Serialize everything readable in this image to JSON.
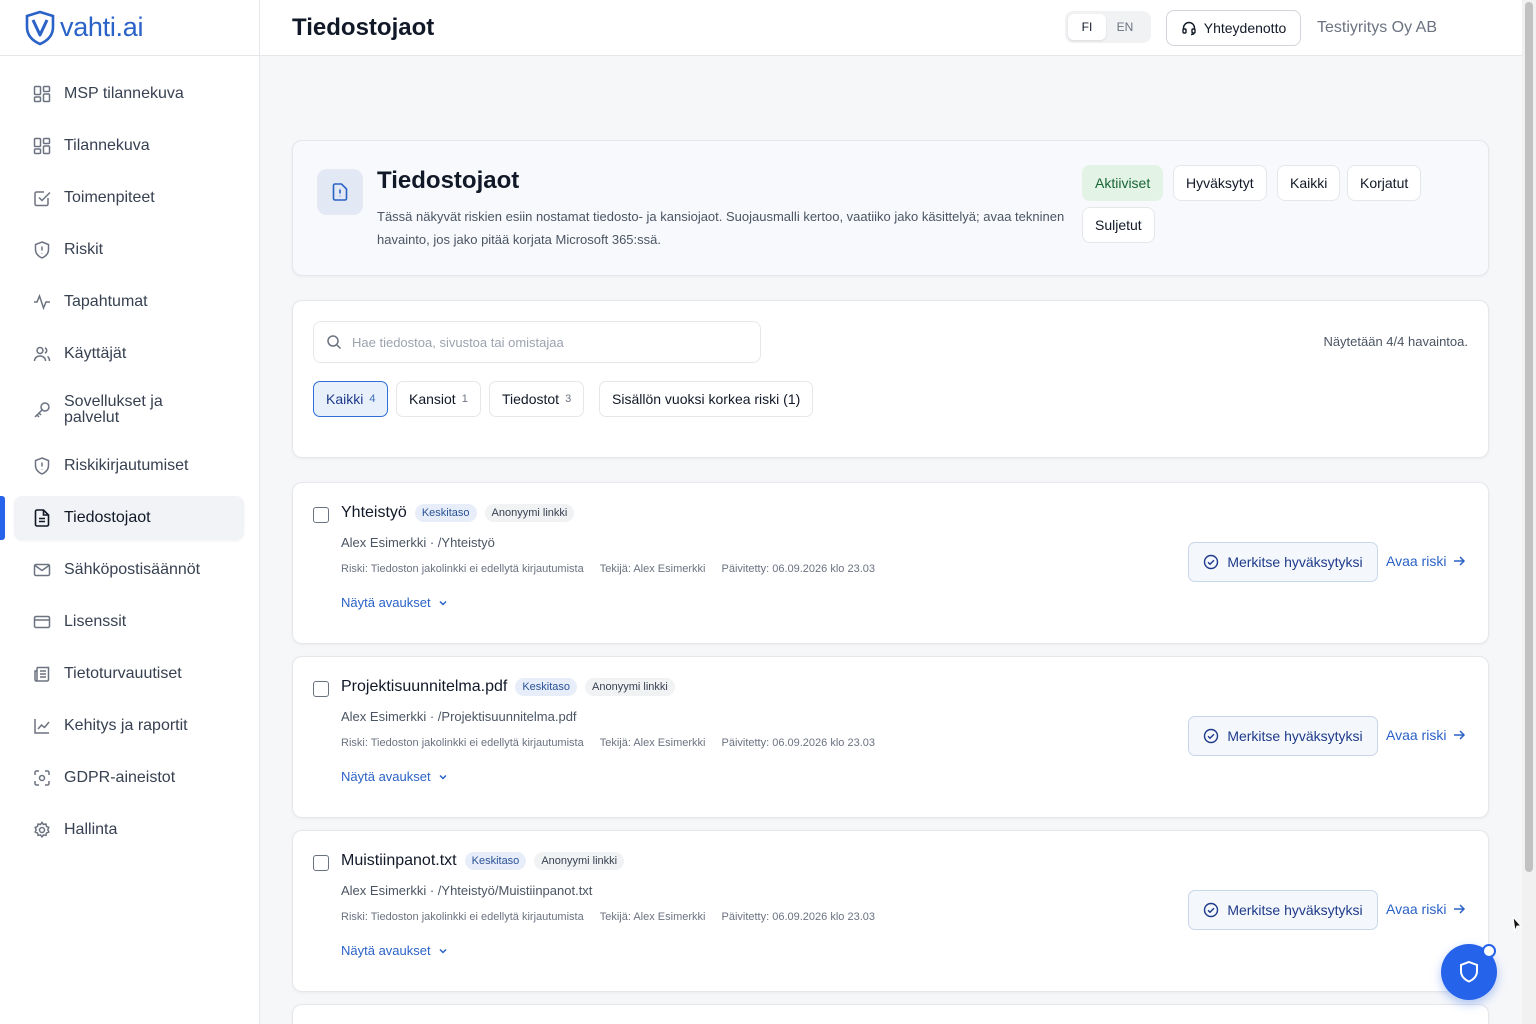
{
  "logo": {
    "text": "vahti.ai"
  },
  "sidebar": {
    "items": [
      {
        "label": "MSP tilannekuva",
        "icon": "dashboard-icon"
      },
      {
        "label": "Tilannekuva",
        "icon": "dashboard-icon"
      },
      {
        "label": "Toimenpiteet",
        "icon": "checkbox-icon"
      },
      {
        "label": "Riskit",
        "icon": "shield-alert-icon"
      },
      {
        "label": "Tapahtumat",
        "icon": "activity-icon"
      },
      {
        "label": "Käyttäjät",
        "icon": "users-icon"
      },
      {
        "label": "Sovellukset ja palvelut",
        "icon": "key-icon"
      },
      {
        "label": "Riskikirjautumiset",
        "icon": "shield-alert-icon"
      },
      {
        "label": "Tiedostojaot",
        "icon": "file-text-icon",
        "active": true
      },
      {
        "label": "Sähköpostisäännöt",
        "icon": "mail-icon"
      },
      {
        "label": "Lisenssit",
        "icon": "credit-card-icon"
      },
      {
        "label": "Tietoturvauutiset",
        "icon": "newspaper-icon"
      },
      {
        "label": "Kehitys ja raportit",
        "icon": "line-chart-icon"
      },
      {
        "label": "GDPR-aineistot",
        "icon": "scan-icon"
      },
      {
        "label": "Hallinta",
        "icon": "gear-icon"
      }
    ]
  },
  "header": {
    "title": "Tiedostojaot",
    "lang": {
      "fi": "FI",
      "en": "EN",
      "selected": "FI"
    },
    "contact_label": "Yhteydenotto",
    "company": "Testiyritys Oy AB"
  },
  "hero": {
    "title": "Tiedostojaot",
    "description": "Tässä näkyvät riskien esiin nostamat tiedosto- ja kansiojaot. Suojausmalli kertoo, vaatiiko jako käsittelyä; avaa tekninen havainto, jos jako pitää korjata Microsoft 365:ssä.",
    "states": [
      "Aktiiviset",
      "Hyväksytyt",
      "Kaikki",
      "Korjatut",
      "Suljetut"
    ],
    "selected_state": "Aktiiviset"
  },
  "filters": {
    "search_placeholder": "Hae tiedostoa, sivustoa tai omistajaa",
    "count_text": "Näytetään 4/4 havaintoa.",
    "chips": [
      {
        "label": "Kaikki",
        "count": "4"
      },
      {
        "label": "Kansiot",
        "count": "1"
      },
      {
        "label": "Tiedostot",
        "count": "3"
      },
      {
        "label": "Sisällön vuoksi korkea riski (1)",
        "count": ""
      }
    ],
    "selected_chip": "Kaikki"
  },
  "items": [
    {
      "title": "Yhteistyö",
      "level": "Keskitaso",
      "link_type": "Anonyymi linkki",
      "path": "Alex Esimerkki · /Yhteistyö",
      "risk": "Riski: Tiedoston jakolinkki ei edellytä kirjautumista",
      "author": "Tekijä: Alex Esimerkki",
      "updated": "Päivitetty: 06.09.2026 klo 23.03",
      "expand_label": "Näytä avaukset",
      "approve_label": "Merkitse hyväksytyksi",
      "open_label": "Avaa riski"
    },
    {
      "title": "Projektisuunnitelma.pdf",
      "level": "Keskitaso",
      "link_type": "Anonyymi linkki",
      "path": "Alex Esimerkki · /Projektisuunnitelma.pdf",
      "risk": "Riski: Tiedoston jakolinkki ei edellytä kirjautumista",
      "author": "Tekijä: Alex Esimerkki",
      "updated": "Päivitetty: 06.09.2026 klo 23.03",
      "expand_label": "Näytä avaukset",
      "approve_label": "Merkitse hyväksytyksi",
      "open_label": "Avaa riski"
    },
    {
      "title": "Muistiinpanot.txt",
      "level": "Keskitaso",
      "link_type": "Anonyymi linkki",
      "path": "Alex Esimerkki · /Yhteistyö/Muistiinpanot.txt",
      "risk": "Riski: Tiedoston jakolinkki ei edellytä kirjautumista",
      "author": "Tekijä: Alex Esimerkki",
      "updated": "Päivitetty: 06.09.2026 klo 23.03",
      "expand_label": "Näytä avaukset",
      "approve_label": "Merkitse hyväksytyksi",
      "open_label": "Avaa riski"
    }
  ],
  "colors": {
    "accent": "#2563eb",
    "brand": "#2a62c7",
    "active_state_bg": "#e3f3e6"
  }
}
